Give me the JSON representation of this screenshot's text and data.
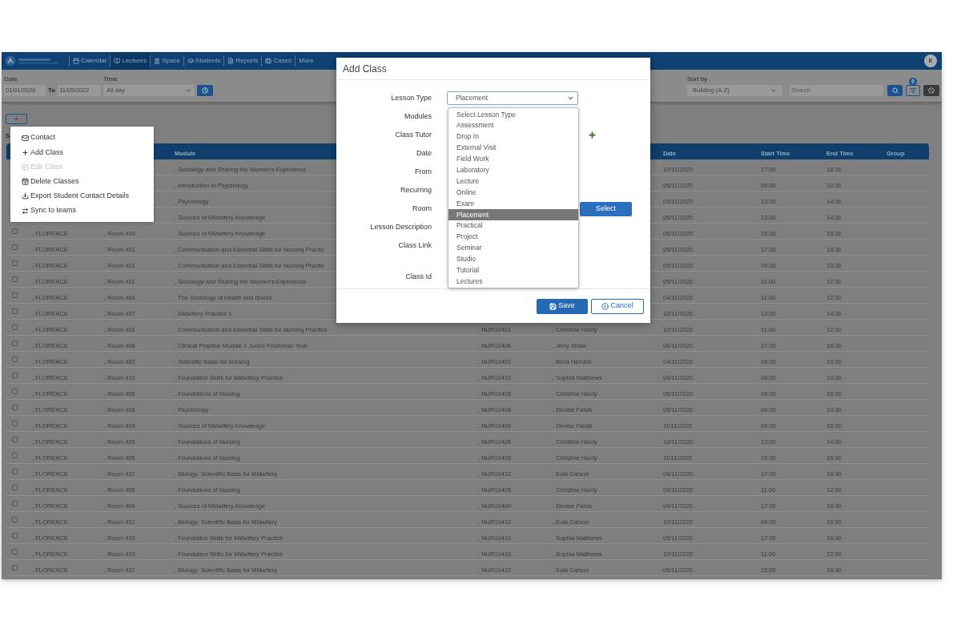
{
  "nav": {
    "items": [
      {
        "label": "Calendar",
        "selected": false
      },
      {
        "label": "Lectures",
        "selected": true
      },
      {
        "label": "Space",
        "selected": false
      },
      {
        "label": "Students",
        "selected": false
      },
      {
        "label": "Reports",
        "selected": false
      },
      {
        "label": "Cases",
        "selected": false
      },
      {
        "label": "More",
        "selected": false
      }
    ],
    "avatar": "E"
  },
  "filters": {
    "date_label": "Date",
    "date_from": "01/01/2020",
    "to_label": "To",
    "date_to": "11/05/2022",
    "time_label": "Time",
    "time_value": "All day",
    "sort_label": "Sort by",
    "sort_value": "Building (A-Z)",
    "search_placeholder": "Search",
    "filter_count": "0"
  },
  "add_button": "+",
  "selection_label": "S",
  "context_menu": [
    {
      "label": "Contact",
      "disabled": false
    },
    {
      "label": "Add Class",
      "disabled": false
    },
    {
      "label": "Edit Class",
      "disabled": true
    },
    {
      "label": "Delete Classes",
      "disabled": false
    },
    {
      "label": "Export Student Contact Details",
      "disabled": false
    },
    {
      "label": "Sync to teams",
      "disabled": false
    }
  ],
  "table": {
    "columns": [
      {
        "label": "Module"
      },
      {
        "label": "Date"
      },
      {
        "label": "Start Time"
      },
      {
        "label": "End Time"
      },
      {
        "label": "Group"
      }
    ],
    "rows": [
      {
        "module": ", Sociology and Sharing the Women's Experience",
        "date": "10/11/2020",
        "start": "17:00",
        "end": "18:30"
      },
      {
        "module": ", Introduction to Psychology",
        "date": "05/11/2020",
        "start": "09:00",
        "end": "10:30"
      },
      {
        "module": ", Psychology",
        "date": "09/11/2020",
        "start": "13:00",
        "end": "14:30"
      },
      {
        "module": ", Sources of Midwifery Knowledge",
        "date": "05/11/2020",
        "start": "13:00",
        "end": "14:30"
      },
      {
        "checked": false,
        "building": ", FLORENCE",
        "room": ", Room 409",
        "module": ", Sources of Midwifery Knowledge",
        "date": "06/11/2020",
        "start": "15:00",
        "end": "16:30"
      },
      {
        "checked": false,
        "building": ", FLORENCE",
        "room": ", Room 401",
        "module": ", Communication and Essential Skills for Nursing Practic",
        "date": "05/11/2020",
        "start": "17:00",
        "end": "18:30"
      },
      {
        "checked": false,
        "building": ", FLORENCE",
        "room": ", Room 401",
        "module": ", Communication and Essential Skills for Nursing Practic",
        "date": "09/11/2020",
        "start": "09:00",
        "end": "10:30"
      },
      {
        "checked": false,
        "building": ", FLORENCE",
        "room": ", Room 411",
        "module": ", Sociology and Sharing the Women's Experience",
        "date": "05/11/2020",
        "start": "11:00",
        "end": "12:30"
      },
      {
        "checked": false,
        "building": ", FLORENCE",
        "room": ", Room 404",
        "module": ", The Sociology of Health and Illness",
        "date": "04/11/2020",
        "start": "11:00",
        "end": "12:30"
      },
      {
        "checked": false,
        "building": ", FLORENCE",
        "room": ", Room 407",
        "module": ", Midwifery Practice 1",
        "date": "10/11/2020",
        "start": "13:00",
        "end": "14:30"
      },
      {
        "checked": false,
        "building": ", FLORENCE",
        "room": ", Room 401",
        "module": ", Communication and Essential Skills for Nursing Practice",
        "code": ", NUR10401",
        "tutor": ", Christine Hardy",
        "date": "10/11/2020",
        "start": "11:00",
        "end": "12:30"
      },
      {
        "checked": false,
        "building": ", FLORENCE",
        "room": ", Room 406",
        "module": ", Clinical Practice Module 1 Junior Freshman Year",
        "code": ", NUR10406",
        "tutor": ", Jerry Shaw",
        "date": "06/11/2020",
        "start": "17:00",
        "end": "18:30"
      },
      {
        "checked": false,
        "building": ", FLORENCE",
        "room": ", Room 402",
        "module": ", Scientific Basis for Nursing",
        "code": ", NUR10402",
        "tutor": ", Alma Hendrix",
        "date": "04/11/2020",
        "start": "09:00",
        "end": "10:30"
      },
      {
        "checked": false,
        "building": ", FLORENCE",
        "room": ", Room 410",
        "module": ", Foundation Skills for Midwifery Practice",
        "code": ", NUR10410",
        "tutor": ", Sophia Matthews",
        "date": "09/11/2020",
        "start": "09:00",
        "end": "10:30"
      },
      {
        "checked": false,
        "building": ", FLORENCE",
        "room": ", Room 405",
        "module": ", Foundations of Nursing",
        "code": ", NUR10405",
        "tutor": ", Christine Hardy",
        "date": "06/11/2020",
        "start": "09:00",
        "end": "10:30"
      },
      {
        "checked": false,
        "building": ", FLORENCE",
        "room": ", Room 408",
        "module": ", Psychology",
        "code": ", NUR10408",
        "tutor": ", Denise Fields",
        "date": "05/11/2020",
        "start": "09:00",
        "end": "10:30"
      },
      {
        "checked": false,
        "building": ", FLORENCE",
        "room": ", Room 409",
        "module": ", Sources of Midwifery Knowledge",
        "code": ", NUR10409",
        "tutor": ", Denise Fields",
        "date": "11/11/2020",
        "start": "09:00",
        "end": "10:30"
      },
      {
        "checked": false,
        "building": ", FLORENCE",
        "room": ", Room 405",
        "module": ", Foundations of Nursing",
        "code": ", NUR10405",
        "tutor": ", Christine Hardy",
        "date": "10/11/2020",
        "start": "13:00",
        "end": "14:30"
      },
      {
        "checked": false,
        "building": ", FLORENCE",
        "room": ", Room 405",
        "module": ", Foundations of Nursing",
        "code": ", NUR10405",
        "tutor": ", Christine Hardy",
        "date": "11/11/2020",
        "start": "15:00",
        "end": "16:30"
      },
      {
        "checked": false,
        "building": ", FLORENCE",
        "room": ", Room 412",
        "module": ", Biology: Scientific Basis for Midwifery",
        "code": ", NUR10412",
        "tutor": ", Eula Carson",
        "date": "06/11/2020",
        "start": "17:00",
        "end": "18:30"
      },
      {
        "checked": false,
        "building": ", FLORENCE",
        "room": ", Room 405",
        "module": ", Foundations of Nursing",
        "code": ", NUR10405",
        "tutor": ", Christine Hardy",
        "date": "09/11/2020",
        "start": "11:00",
        "end": "12:30"
      },
      {
        "checked": false,
        "building": ", FLORENCE",
        "room": ", Room 409",
        "module": ", Sources of Midwifery Knowledge",
        "code": ", NUR10409",
        "tutor": ", Denise Fields",
        "date": "09/11/2020",
        "start": "17:00",
        "end": "18:30"
      },
      {
        "checked": false,
        "building": ", FLORENCE",
        "room": ", Room 412",
        "module": ", Biology: Scientific Basis for Midwifery",
        "code": ", NUR10412",
        "tutor": ", Eula Carson",
        "date": "10/11/2020",
        "start": "09:00",
        "end": "10:30"
      },
      {
        "checked": false,
        "building": ", FLORENCE",
        "room": ", Room 410",
        "module": ", Foundation Skills for Midwifery Practice",
        "code": ", NUR10410",
        "tutor": ", Sophia Matthews",
        "date": "05/11/2020",
        "start": "17:00",
        "end": "18:30"
      },
      {
        "checked": false,
        "building": ", FLORENCE",
        "room": ", Room 410",
        "module": ", Foundation Skills for Midwifery Practice",
        "code": ", NUR10410",
        "tutor": ", Sophia Matthews",
        "date": "10/11/2020",
        "start": "11:00",
        "end": "12:30"
      },
      {
        "checked": false,
        "building": ", FLORENCE",
        "room": ", Room 412",
        "module": ", Biology: Scientific Basis for Midwifery",
        "code": ", NUR10412",
        "tutor": ", Eula Carson",
        "date": "05/11/2020",
        "start": "15:00",
        "end": "16:30"
      }
    ]
  },
  "modal": {
    "title": "Add Class",
    "fields": [
      {
        "label": "Lesson Type",
        "kind": "select"
      },
      {
        "label": "Modules",
        "kind": "plain"
      },
      {
        "label": "Class Tutor",
        "kind": "add"
      },
      {
        "label": "Date",
        "kind": "plain"
      },
      {
        "label": "From",
        "kind": "plain"
      },
      {
        "label": "Recurring",
        "kind": "plain"
      },
      {
        "label": "Room",
        "kind": "button"
      },
      {
        "label": "Lesson Description",
        "kind": "plain"
      },
      {
        "label": "Class Link",
        "kind": "plain"
      },
      {
        "label": "Class Id",
        "kind": "plain"
      }
    ],
    "lesson_type": {
      "value": "Placement",
      "expanded": true,
      "options": [
        {
          "label": "Select Lesson Type",
          "selected": false
        },
        {
          "label": "Assessment",
          "selected": false
        },
        {
          "label": "Drop In",
          "selected": false
        },
        {
          "label": "External Visit",
          "selected": false
        },
        {
          "label": "Field Work",
          "selected": false
        },
        {
          "label": "Laboratory",
          "selected": false
        },
        {
          "label": "Lecture",
          "selected": false
        },
        {
          "label": "Online",
          "selected": false
        },
        {
          "label": "Exam",
          "selected": false
        },
        {
          "label": "Placement",
          "selected": true
        },
        {
          "label": "Practical",
          "selected": false
        },
        {
          "label": "Project",
          "selected": false
        },
        {
          "label": "Seminar",
          "selected": false
        },
        {
          "label": "Studio",
          "selected": false
        },
        {
          "label": "Tutorial",
          "selected": false
        },
        {
          "label": "Lectures",
          "selected": false
        }
      ]
    },
    "select_button": "Select",
    "save_button": "Save",
    "cancel_button": "Cancel"
  }
}
